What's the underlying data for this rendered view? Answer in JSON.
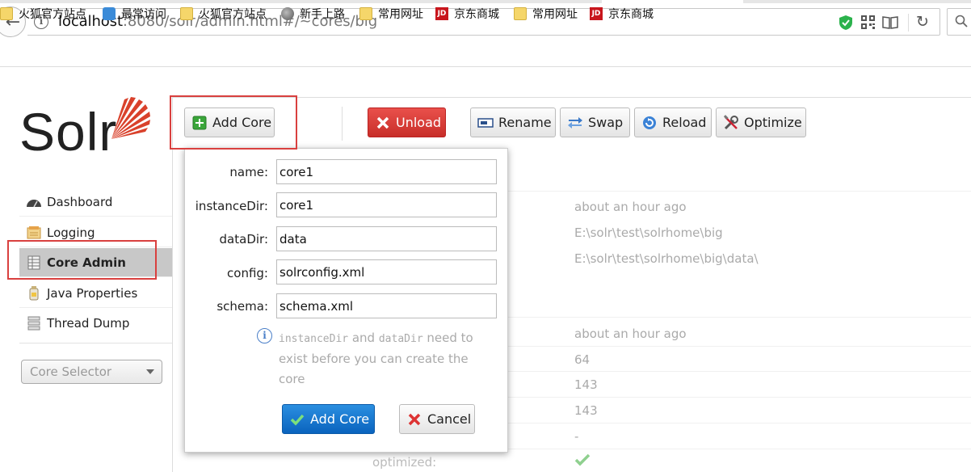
{
  "browser": {
    "url_host": "localhost",
    "url_rest": ":8080/solr/admin.html#/~cores/big"
  },
  "bookmarks": [
    {
      "label": "火狐官方站点",
      "icon": "folder-icon"
    },
    {
      "label": "最常访问",
      "icon": "most-visited-icon"
    },
    {
      "label": "火狐官方站点",
      "icon": "folder-icon"
    },
    {
      "label": "新手上路",
      "icon": "globe-icon"
    },
    {
      "label": "常用网址",
      "icon": "folder-icon"
    },
    {
      "label": "京东商城",
      "icon": "jd-icon"
    },
    {
      "label": "常用网址",
      "icon": "folder-icon"
    },
    {
      "label": "京东商城",
      "icon": "jd-icon"
    }
  ],
  "logo": {
    "text": "Solr"
  },
  "nav": {
    "items": [
      {
        "label": "Dashboard",
        "icon": "dashboard-icon"
      },
      {
        "label": "Logging",
        "icon": "logging-icon"
      },
      {
        "label": "Core Admin",
        "icon": "core-admin-icon",
        "active": true
      },
      {
        "label": "Java Properties",
        "icon": "java-icon"
      },
      {
        "label": "Thread Dump",
        "icon": "thread-dump-icon"
      }
    ],
    "core_selector": "Core Selector"
  },
  "toolbar": {
    "add_core": "Add Core",
    "unload": "Unload",
    "rename": "Rename",
    "swap": "Swap",
    "reload": "Reload",
    "optimize": "Optimize"
  },
  "core_info": {
    "start_time": "about an hour ago",
    "instance_dir": "E:\\solr\\test\\solrhome\\big",
    "data_dir": "E:\\solr\\test\\solrhome\\big\\data\\",
    "last_modified": "about an hour ago",
    "version": "64",
    "num_docs": "143",
    "max_doc": "143",
    "deleted_docs": "-",
    "optimized_label": "optimized:"
  },
  "dialog": {
    "name_label": "name:",
    "name_value": "core1",
    "instance_dir_label": "instanceDir:",
    "instance_dir_value": "core1",
    "data_dir_label": "dataDir:",
    "data_dir_value": "data",
    "config_label": "config:",
    "config_value": "solrconfig.xml",
    "schema_label": "schema:",
    "schema_value": "schema.xml",
    "hint_code1": "instanceDir",
    "hint_and": " and ",
    "hint_code2": "dataDir",
    "hint_rest": " need to exist before you can create the core",
    "submit": "Add Core",
    "cancel": "Cancel"
  },
  "colors": {
    "highlight": "#d9403f",
    "unload": "#d43f3a",
    "submit": "#0b6fc9"
  }
}
